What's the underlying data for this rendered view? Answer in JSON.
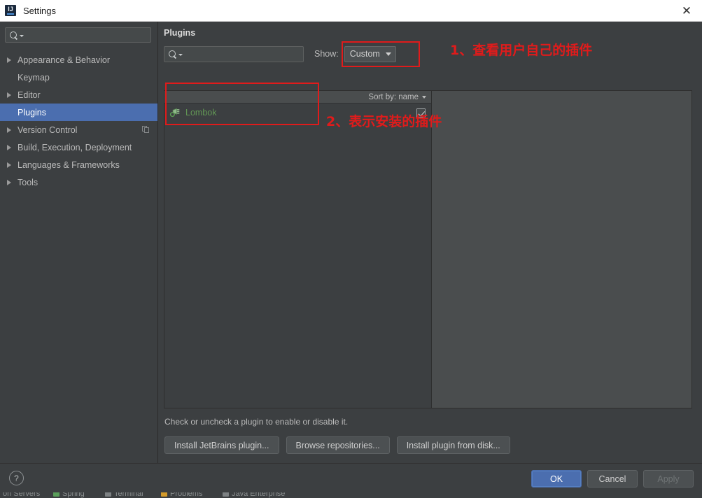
{
  "window": {
    "title": "Settings",
    "app_icon": "intellij-idea-icon",
    "close_icon": "close-icon"
  },
  "sidebar": {
    "search": {
      "placeholder": "",
      "value": "",
      "icon": "search-icon"
    },
    "items": [
      {
        "label": "Appearance & Behavior",
        "expandable": true,
        "selected": false,
        "trailing_icon": ""
      },
      {
        "label": "Keymap",
        "expandable": false,
        "selected": false,
        "trailing_icon": ""
      },
      {
        "label": "Editor",
        "expandable": true,
        "selected": false,
        "trailing_icon": ""
      },
      {
        "label": "Plugins",
        "expandable": false,
        "selected": true,
        "trailing_icon": ""
      },
      {
        "label": "Version Control",
        "expandable": true,
        "selected": false,
        "trailing_icon": "copy-icon"
      },
      {
        "label": "Build, Execution, Deployment",
        "expandable": true,
        "selected": false,
        "trailing_icon": ""
      },
      {
        "label": "Languages & Frameworks",
        "expandable": true,
        "selected": false,
        "trailing_icon": ""
      },
      {
        "label": "Tools",
        "expandable": true,
        "selected": false,
        "trailing_icon": ""
      }
    ]
  },
  "main": {
    "header": "Plugins",
    "search": {
      "placeholder": "",
      "value": "",
      "icon": "search-icon"
    },
    "show_label": "Show:",
    "show_value": "Custom",
    "sort_label": "Sort by: name",
    "plugins": [
      {
        "name": "Lombok",
        "enabled": true,
        "icon": "plugin-plug-icon"
      }
    ],
    "hint": "Check or uncheck a plugin to enable or disable it.",
    "install_buttons": [
      "Install JetBrains plugin...",
      "Browse repositories...",
      "Install plugin from disk..."
    ]
  },
  "footer": {
    "help_label": "?",
    "ok": "OK",
    "cancel": "Cancel",
    "apply": "Apply"
  },
  "ide_strip": {
    "items": [
      "on Servers",
      "Spring",
      "Terminal",
      "Problems",
      "Java Enterprise"
    ]
  },
  "annotations": [
    {
      "id": "note-1",
      "text": "1、查看用户自己的插件"
    },
    {
      "id": "note-2",
      "text": "2、表示安装的插件"
    }
  ],
  "colors": {
    "accent": "#4b6eaf",
    "annotation": "#e01b1b",
    "plugin_enabled": "#629755",
    "panel_bg": "#3c3f41"
  }
}
